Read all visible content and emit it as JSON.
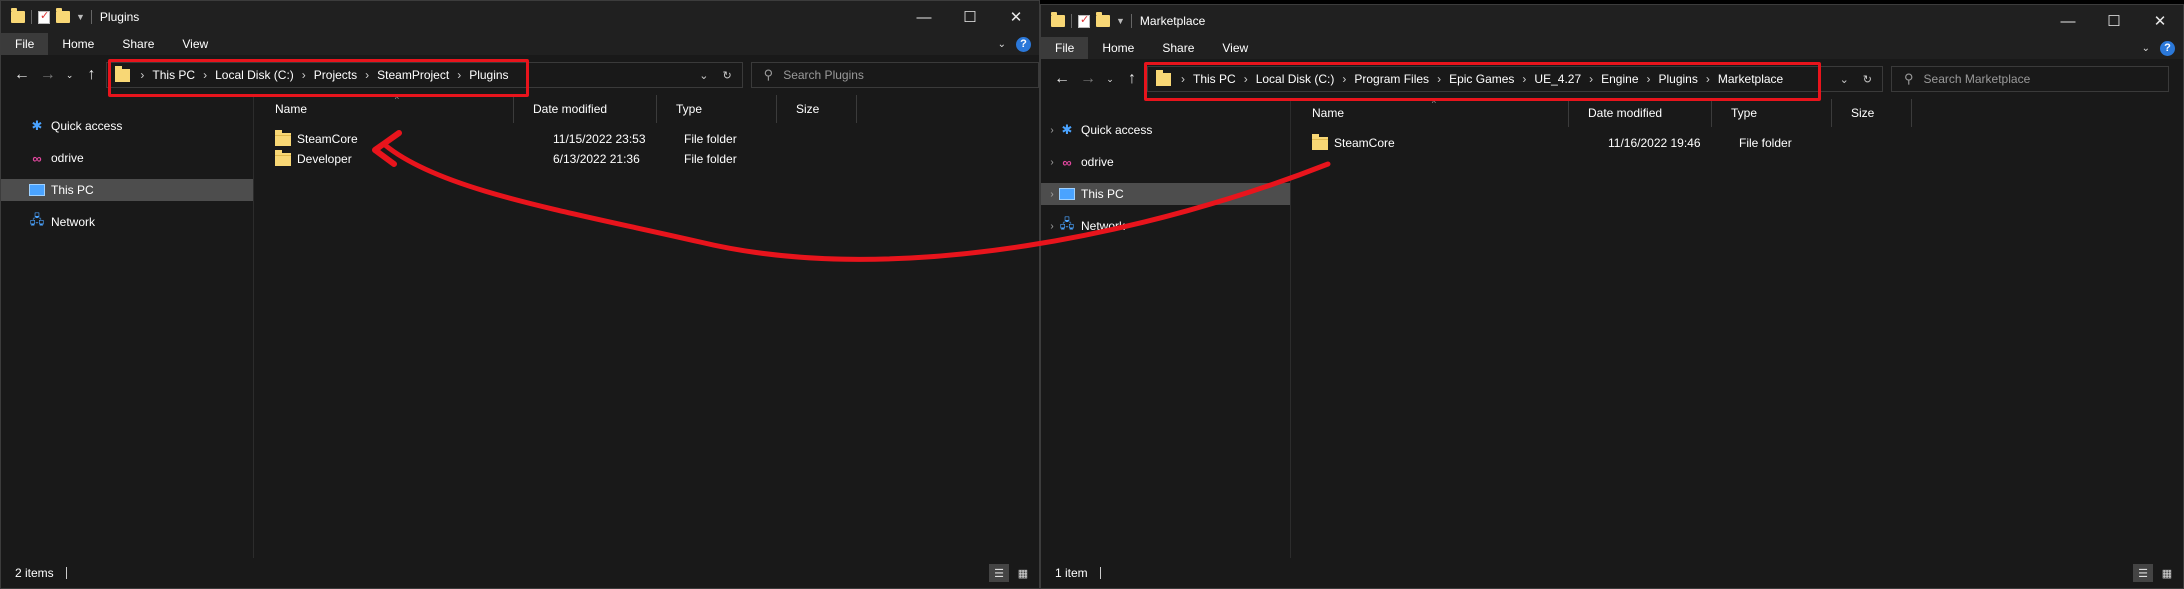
{
  "left_window": {
    "title": "Plugins",
    "tabs": [
      "File",
      "Home",
      "Share",
      "View"
    ],
    "breadcrumb": [
      "This PC",
      "Local Disk (C:)",
      "Projects",
      "SteamProject",
      "Plugins"
    ],
    "search_placeholder": "Search Plugins",
    "nav_tree": [
      {
        "label": "Quick access",
        "icon": "star-icon"
      },
      {
        "label": "odrive",
        "icon": "odrive-icon"
      },
      {
        "label": "This PC",
        "icon": "monitor-icon"
      },
      {
        "label": "Network",
        "icon": "network-icon"
      }
    ],
    "columns": [
      "Name",
      "Date modified",
      "Type",
      "Size"
    ],
    "files": [
      {
        "name": "SteamCore",
        "date": "11/15/2022 23:53",
        "type": "File folder",
        "size": ""
      },
      {
        "name": "Developer",
        "date": "6/13/2022 21:36",
        "type": "File folder",
        "size": ""
      }
    ],
    "status": "2 items"
  },
  "right_window": {
    "title": "Marketplace",
    "tabs": [
      "File",
      "Home",
      "Share",
      "View"
    ],
    "breadcrumb": [
      "This PC",
      "Local Disk (C:)",
      "Program Files",
      "Epic Games",
      "UE_4.27",
      "Engine",
      "Plugins",
      "Marketplace"
    ],
    "search_placeholder": "Search Marketplace",
    "nav_tree": [
      {
        "label": "Quick access",
        "icon": "star-icon"
      },
      {
        "label": "odrive",
        "icon": "odrive-icon"
      },
      {
        "label": "This PC",
        "icon": "monitor-icon",
        "selected": true
      },
      {
        "label": "Network",
        "icon": "network-icon"
      }
    ],
    "columns": [
      "Name",
      "Date modified",
      "Type",
      "Size"
    ],
    "files": [
      {
        "name": "SteamCore",
        "date": "11/16/2022 19:46",
        "type": "File folder",
        "size": ""
      }
    ],
    "status": "1 item"
  },
  "colors": {
    "annotation_red": "#e8141c",
    "window_bg": "#191919",
    "chrome_bg": "#202020",
    "folder_yellow": "#f8d775",
    "accent_blue": "#2b78d9"
  }
}
